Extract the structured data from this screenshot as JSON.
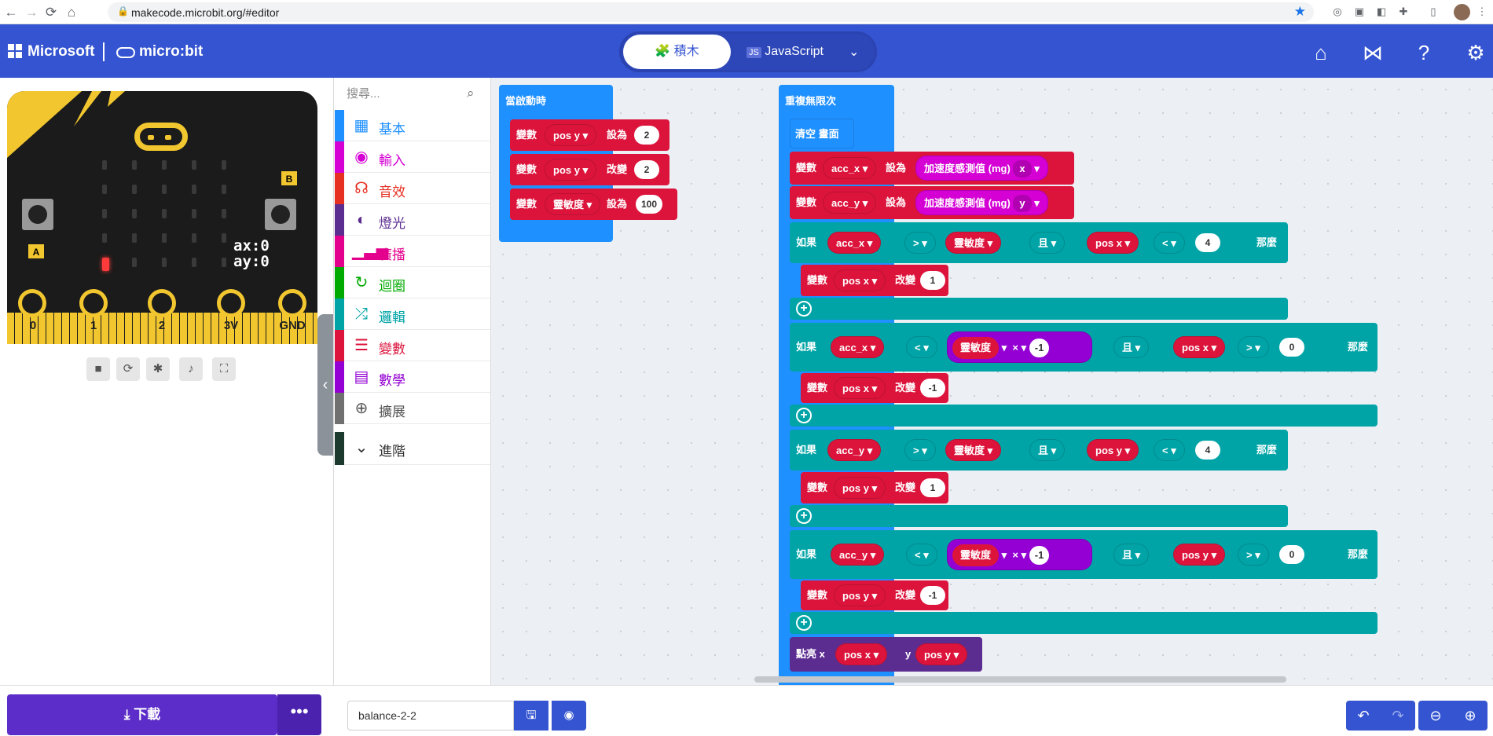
{
  "browser": {
    "url": "makecode.microbit.org/#editor"
  },
  "header": {
    "brand": "Microsoft",
    "product": "micro:bit",
    "tab_blocks": "積木",
    "tab_js": "JavaScript"
  },
  "simulator": {
    "readout_x": "ax:0",
    "readout_y": "ay:0",
    "button_a": "A",
    "button_b": "B",
    "pins": [
      "0",
      "1",
      "2",
      "3V",
      "GND"
    ]
  },
  "toolbox": {
    "search_placeholder": "搜尋...",
    "categories": [
      {
        "label": "基本",
        "color": "#1e90ff",
        "icon": "grid-icon"
      },
      {
        "label": "輸入",
        "color": "#d400d4",
        "icon": "circle-dot-icon"
      },
      {
        "label": "音效",
        "color": "#e63022",
        "icon": "headphones-icon"
      },
      {
        "label": "燈光",
        "color": "#5c2d91",
        "icon": "toggle-icon"
      },
      {
        "label": "廣播",
        "color": "#e3008c",
        "icon": "signal-icon"
      },
      {
        "label": "迴圈",
        "color": "#00aa00",
        "icon": "refresh-icon"
      },
      {
        "label": "邏輯",
        "color": "#00a4a6",
        "icon": "shuffle-icon"
      },
      {
        "label": "變數",
        "color": "#dc143c",
        "icon": "list-icon"
      },
      {
        "label": "數學",
        "color": "#9400d3",
        "icon": "calculator-icon"
      },
      {
        "label": "擴展",
        "color": "#707070",
        "icon": "plus-circle-icon"
      }
    ],
    "advanced": "進階"
  },
  "workspace": {
    "on_start": {
      "hat": "當啟動時",
      "rows": [
        {
          "kw": "變數",
          "var": "pos y",
          "op": "設為",
          "val": "2"
        },
        {
          "kw": "變數",
          "var": "pos y",
          "op": "改變",
          "val": "2"
        },
        {
          "kw": "變數",
          "var": "靈敏度",
          "op": "設為",
          "val": "100"
        }
      ]
    },
    "forever": {
      "hat": "重複無限次",
      "clear": "清空 畫面",
      "set_x": {
        "kw": "變數",
        "var": "acc_x",
        "op": "設為",
        "fn": "加速度感測值 (mg)",
        "axis": "x"
      },
      "set_y": {
        "kw": "變數",
        "var": "acc_y",
        "op": "設為",
        "fn": "加速度感測值 (mg)",
        "axis": "y"
      },
      "if1": {
        "kw": "如果",
        "a": "acc_x",
        "cmp1": ">",
        "b": "靈敏度",
        "and": "且",
        "c": "pos x",
        "cmp2": "<",
        "d": "4",
        "then": "那麼",
        "body_var": "pos x",
        "body_op": "改變",
        "body_val": "1"
      },
      "if2": {
        "kw": "如果",
        "a": "acc_x",
        "cmp1": "<",
        "b": "靈敏度",
        "mul": "×",
        "neg": "-1",
        "and": "且",
        "c": "pos x",
        "cmp2": ">",
        "d": "0",
        "then": "那麼",
        "body_var": "pos x",
        "body_op": "改變",
        "body_val": "-1"
      },
      "if3": {
        "kw": "如果",
        "a": "acc_y",
        "cmp1": ">",
        "b": "靈敏度",
        "and": "且",
        "c": "pos y",
        "cmp2": "<",
        "d": "4",
        "then": "那麼",
        "body_var": "pos y",
        "body_op": "改變",
        "body_val": "1"
      },
      "if4": {
        "kw": "如果",
        "a": "acc_y",
        "cmp1": "<",
        "b": "靈敏度",
        "mul": "×",
        "neg": "-1",
        "and": "且",
        "c": "pos y",
        "cmp2": ">",
        "d": "0",
        "then": "那麼",
        "body_var": "pos y",
        "body_op": "改變",
        "body_val": "-1"
      },
      "plot": {
        "kw": "點亮 x",
        "x": "pos x",
        "ykw": "y",
        "y": "pos y"
      }
    }
  },
  "footer": {
    "download": "下載",
    "more": "•••",
    "project_name": "balance-2-2"
  },
  "colors": {
    "header": "#3454d1",
    "variables": "#dc143c",
    "logic": "#00a4a6",
    "loops": "#1e90ff",
    "math": "#9400d3",
    "input": "#d400d4",
    "led": "#5c2d91"
  }
}
